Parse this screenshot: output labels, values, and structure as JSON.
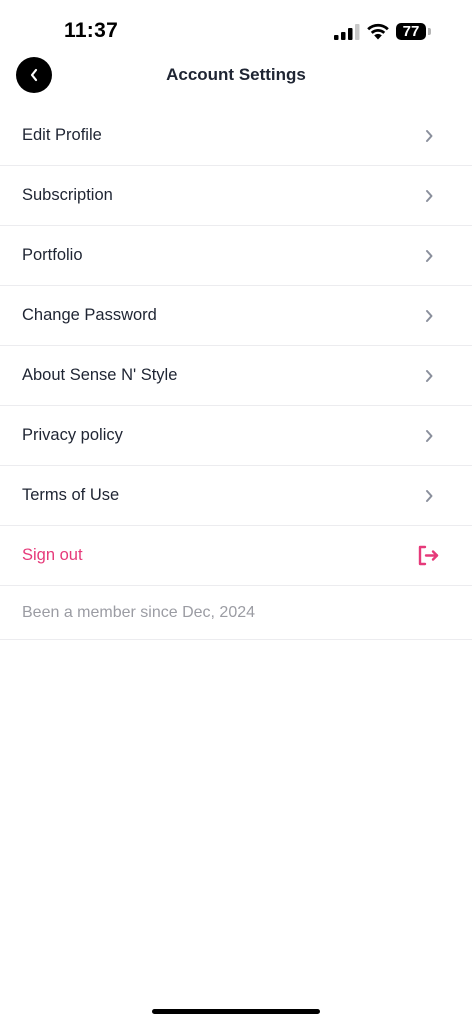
{
  "status_bar": {
    "time": "11:37",
    "battery": "77",
    "icons": [
      "cellular-signal-icon",
      "wifi-icon",
      "battery-icon"
    ]
  },
  "header": {
    "title": "Account Settings",
    "back_icon": "chevron-left-icon"
  },
  "menu": {
    "items": [
      {
        "label": "Edit Profile",
        "icon": "chevron-right-icon"
      },
      {
        "label": "Subscription",
        "icon": "chevron-right-icon"
      },
      {
        "label": "Portfolio",
        "icon": "chevron-right-icon"
      },
      {
        "label": "Change Password",
        "icon": "chevron-right-icon"
      },
      {
        "label": "About Sense N' Style",
        "icon": "chevron-right-icon"
      },
      {
        "label": "Privacy policy",
        "icon": "chevron-right-icon"
      },
      {
        "label": "Terms of Use",
        "icon": "chevron-right-icon"
      }
    ],
    "sign_out": {
      "label": "Sign out",
      "icon": "logout-icon"
    },
    "member_since": "Been a member since Dec, 2024"
  },
  "colors": {
    "text": "#1f2533",
    "accent": "#e63a7a",
    "muted": "#9b9ca3",
    "chevron": "#8a8f9c",
    "divider": "#ececef"
  }
}
